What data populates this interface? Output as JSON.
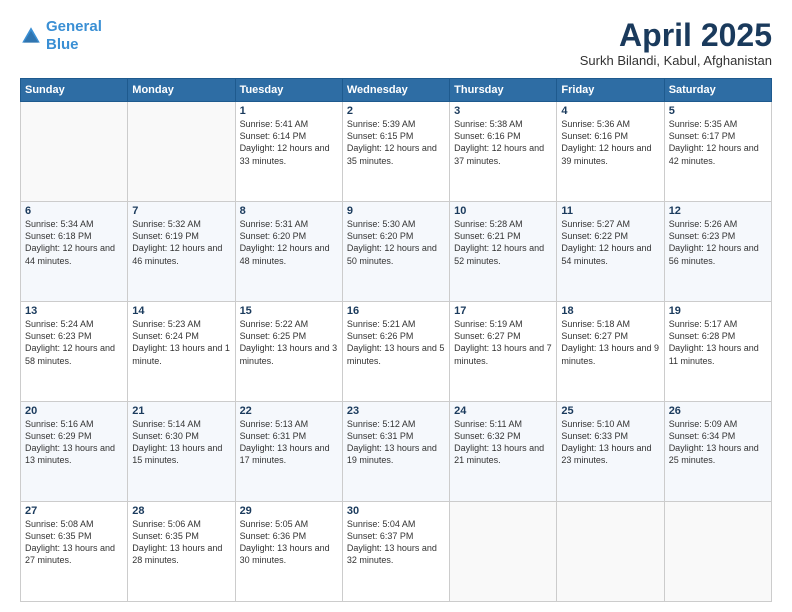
{
  "header": {
    "logo_line1": "General",
    "logo_line2": "Blue",
    "month": "April 2025",
    "location": "Surkh Bilandi, Kabul, Afghanistan"
  },
  "weekdays": [
    "Sunday",
    "Monday",
    "Tuesday",
    "Wednesday",
    "Thursday",
    "Friday",
    "Saturday"
  ],
  "rows": [
    [
      {
        "day": "",
        "sunrise": "",
        "sunset": "",
        "daylight": ""
      },
      {
        "day": "",
        "sunrise": "",
        "sunset": "",
        "daylight": ""
      },
      {
        "day": "1",
        "sunrise": "Sunrise: 5:41 AM",
        "sunset": "Sunset: 6:14 PM",
        "daylight": "Daylight: 12 hours and 33 minutes."
      },
      {
        "day": "2",
        "sunrise": "Sunrise: 5:39 AM",
        "sunset": "Sunset: 6:15 PM",
        "daylight": "Daylight: 12 hours and 35 minutes."
      },
      {
        "day": "3",
        "sunrise": "Sunrise: 5:38 AM",
        "sunset": "Sunset: 6:16 PM",
        "daylight": "Daylight: 12 hours and 37 minutes."
      },
      {
        "day": "4",
        "sunrise": "Sunrise: 5:36 AM",
        "sunset": "Sunset: 6:16 PM",
        "daylight": "Daylight: 12 hours and 39 minutes."
      },
      {
        "day": "5",
        "sunrise": "Sunrise: 5:35 AM",
        "sunset": "Sunset: 6:17 PM",
        "daylight": "Daylight: 12 hours and 42 minutes."
      }
    ],
    [
      {
        "day": "6",
        "sunrise": "Sunrise: 5:34 AM",
        "sunset": "Sunset: 6:18 PM",
        "daylight": "Daylight: 12 hours and 44 minutes."
      },
      {
        "day": "7",
        "sunrise": "Sunrise: 5:32 AM",
        "sunset": "Sunset: 6:19 PM",
        "daylight": "Daylight: 12 hours and 46 minutes."
      },
      {
        "day": "8",
        "sunrise": "Sunrise: 5:31 AM",
        "sunset": "Sunset: 6:20 PM",
        "daylight": "Daylight: 12 hours and 48 minutes."
      },
      {
        "day": "9",
        "sunrise": "Sunrise: 5:30 AM",
        "sunset": "Sunset: 6:20 PM",
        "daylight": "Daylight: 12 hours and 50 minutes."
      },
      {
        "day": "10",
        "sunrise": "Sunrise: 5:28 AM",
        "sunset": "Sunset: 6:21 PM",
        "daylight": "Daylight: 12 hours and 52 minutes."
      },
      {
        "day": "11",
        "sunrise": "Sunrise: 5:27 AM",
        "sunset": "Sunset: 6:22 PM",
        "daylight": "Daylight: 12 hours and 54 minutes."
      },
      {
        "day": "12",
        "sunrise": "Sunrise: 5:26 AM",
        "sunset": "Sunset: 6:23 PM",
        "daylight": "Daylight: 12 hours and 56 minutes."
      }
    ],
    [
      {
        "day": "13",
        "sunrise": "Sunrise: 5:24 AM",
        "sunset": "Sunset: 6:23 PM",
        "daylight": "Daylight: 12 hours and 58 minutes."
      },
      {
        "day": "14",
        "sunrise": "Sunrise: 5:23 AM",
        "sunset": "Sunset: 6:24 PM",
        "daylight": "Daylight: 13 hours and 1 minute."
      },
      {
        "day": "15",
        "sunrise": "Sunrise: 5:22 AM",
        "sunset": "Sunset: 6:25 PM",
        "daylight": "Daylight: 13 hours and 3 minutes."
      },
      {
        "day": "16",
        "sunrise": "Sunrise: 5:21 AM",
        "sunset": "Sunset: 6:26 PM",
        "daylight": "Daylight: 13 hours and 5 minutes."
      },
      {
        "day": "17",
        "sunrise": "Sunrise: 5:19 AM",
        "sunset": "Sunset: 6:27 PM",
        "daylight": "Daylight: 13 hours and 7 minutes."
      },
      {
        "day": "18",
        "sunrise": "Sunrise: 5:18 AM",
        "sunset": "Sunset: 6:27 PM",
        "daylight": "Daylight: 13 hours and 9 minutes."
      },
      {
        "day": "19",
        "sunrise": "Sunrise: 5:17 AM",
        "sunset": "Sunset: 6:28 PM",
        "daylight": "Daylight: 13 hours and 11 minutes."
      }
    ],
    [
      {
        "day": "20",
        "sunrise": "Sunrise: 5:16 AM",
        "sunset": "Sunset: 6:29 PM",
        "daylight": "Daylight: 13 hours and 13 minutes."
      },
      {
        "day": "21",
        "sunrise": "Sunrise: 5:14 AM",
        "sunset": "Sunset: 6:30 PM",
        "daylight": "Daylight: 13 hours and 15 minutes."
      },
      {
        "day": "22",
        "sunrise": "Sunrise: 5:13 AM",
        "sunset": "Sunset: 6:31 PM",
        "daylight": "Daylight: 13 hours and 17 minutes."
      },
      {
        "day": "23",
        "sunrise": "Sunrise: 5:12 AM",
        "sunset": "Sunset: 6:31 PM",
        "daylight": "Daylight: 13 hours and 19 minutes."
      },
      {
        "day": "24",
        "sunrise": "Sunrise: 5:11 AM",
        "sunset": "Sunset: 6:32 PM",
        "daylight": "Daylight: 13 hours and 21 minutes."
      },
      {
        "day": "25",
        "sunrise": "Sunrise: 5:10 AM",
        "sunset": "Sunset: 6:33 PM",
        "daylight": "Daylight: 13 hours and 23 minutes."
      },
      {
        "day": "26",
        "sunrise": "Sunrise: 5:09 AM",
        "sunset": "Sunset: 6:34 PM",
        "daylight": "Daylight: 13 hours and 25 minutes."
      }
    ],
    [
      {
        "day": "27",
        "sunrise": "Sunrise: 5:08 AM",
        "sunset": "Sunset: 6:35 PM",
        "daylight": "Daylight: 13 hours and 27 minutes."
      },
      {
        "day": "28",
        "sunrise": "Sunrise: 5:06 AM",
        "sunset": "Sunset: 6:35 PM",
        "daylight": "Daylight: 13 hours and 28 minutes."
      },
      {
        "day": "29",
        "sunrise": "Sunrise: 5:05 AM",
        "sunset": "Sunset: 6:36 PM",
        "daylight": "Daylight: 13 hours and 30 minutes."
      },
      {
        "day": "30",
        "sunrise": "Sunrise: 5:04 AM",
        "sunset": "Sunset: 6:37 PM",
        "daylight": "Daylight: 13 hours and 32 minutes."
      },
      {
        "day": "",
        "sunrise": "",
        "sunset": "",
        "daylight": ""
      },
      {
        "day": "",
        "sunrise": "",
        "sunset": "",
        "daylight": ""
      },
      {
        "day": "",
        "sunrise": "",
        "sunset": "",
        "daylight": ""
      }
    ]
  ]
}
